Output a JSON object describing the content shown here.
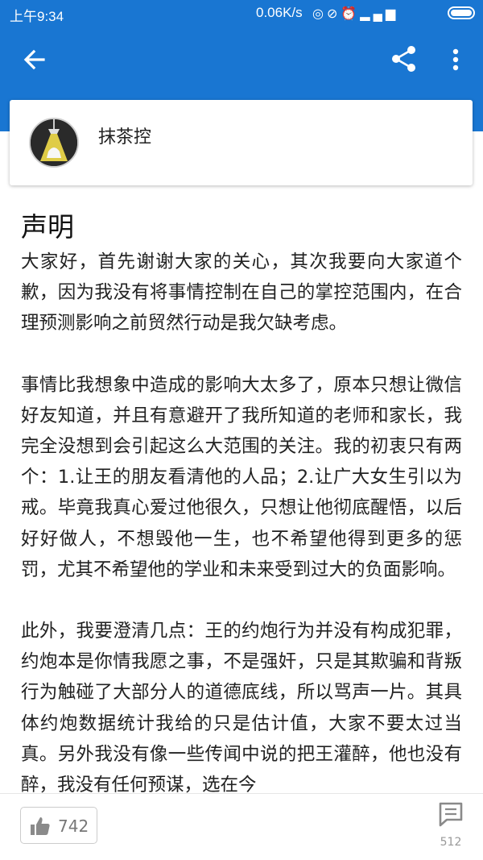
{
  "status_bar": {
    "time": "上午9:34",
    "net_speed": "0.06K/s",
    "icons": [
      "hotspot-icon",
      "mute-icon",
      "alarm-icon",
      "signal-icon",
      "signal-icon",
      "battery-icon"
    ]
  },
  "toolbar": {
    "back_icon": "arrow-left-icon",
    "share_icon": "share-icon",
    "more_icon": "more-vertical-icon",
    "color": "#1976d2"
  },
  "author": {
    "name": "抹茶控",
    "avatar_icon": "avatar-lamp-icon"
  },
  "article": {
    "title": "声明",
    "paragraphs": [
      "大家好，首先谢谢大家的关心，其次我要向大家道个歉，因为我没有将事情控制在自己的掌控范围内，在合理预测影响之前贸然行动是我欠缺考虑。",
      "事情比我想象中造成的影响大太多了，原本只想让微信好友知道，并且有意避开了我所知道的老师和家长，我完全没想到会引起这么大范围的关注。我的初衷只有两个：1.让王的朋友看清他的人品；2.让广大女生引以为戒。毕竟我真心爱过他很久，只想让他彻底醒悟，以后好好做人，不想毁他一生，也不希望他得到更多的惩罚，尤其不希望他的学业和未来受到过大的负面影响。",
      "此外，我要澄清几点：王的约炮行为并没有构成犯罪，约炮本是你情我愿之事，不是强奸，只是其欺骗和背叛行为触碰了大部分人的道德底线，所以骂声一片。其具体约炮数据统计我给的只是估计值，大家不要太过当真。另外我没有像一些传闻中说的把王灌醉，他也没有醉，我没有任何预谋，选在今"
    ]
  },
  "bottom_bar": {
    "like_icon": "thumbs-up-icon",
    "like_count": "742",
    "comment_icon": "comment-icon",
    "comment_count": "512"
  }
}
